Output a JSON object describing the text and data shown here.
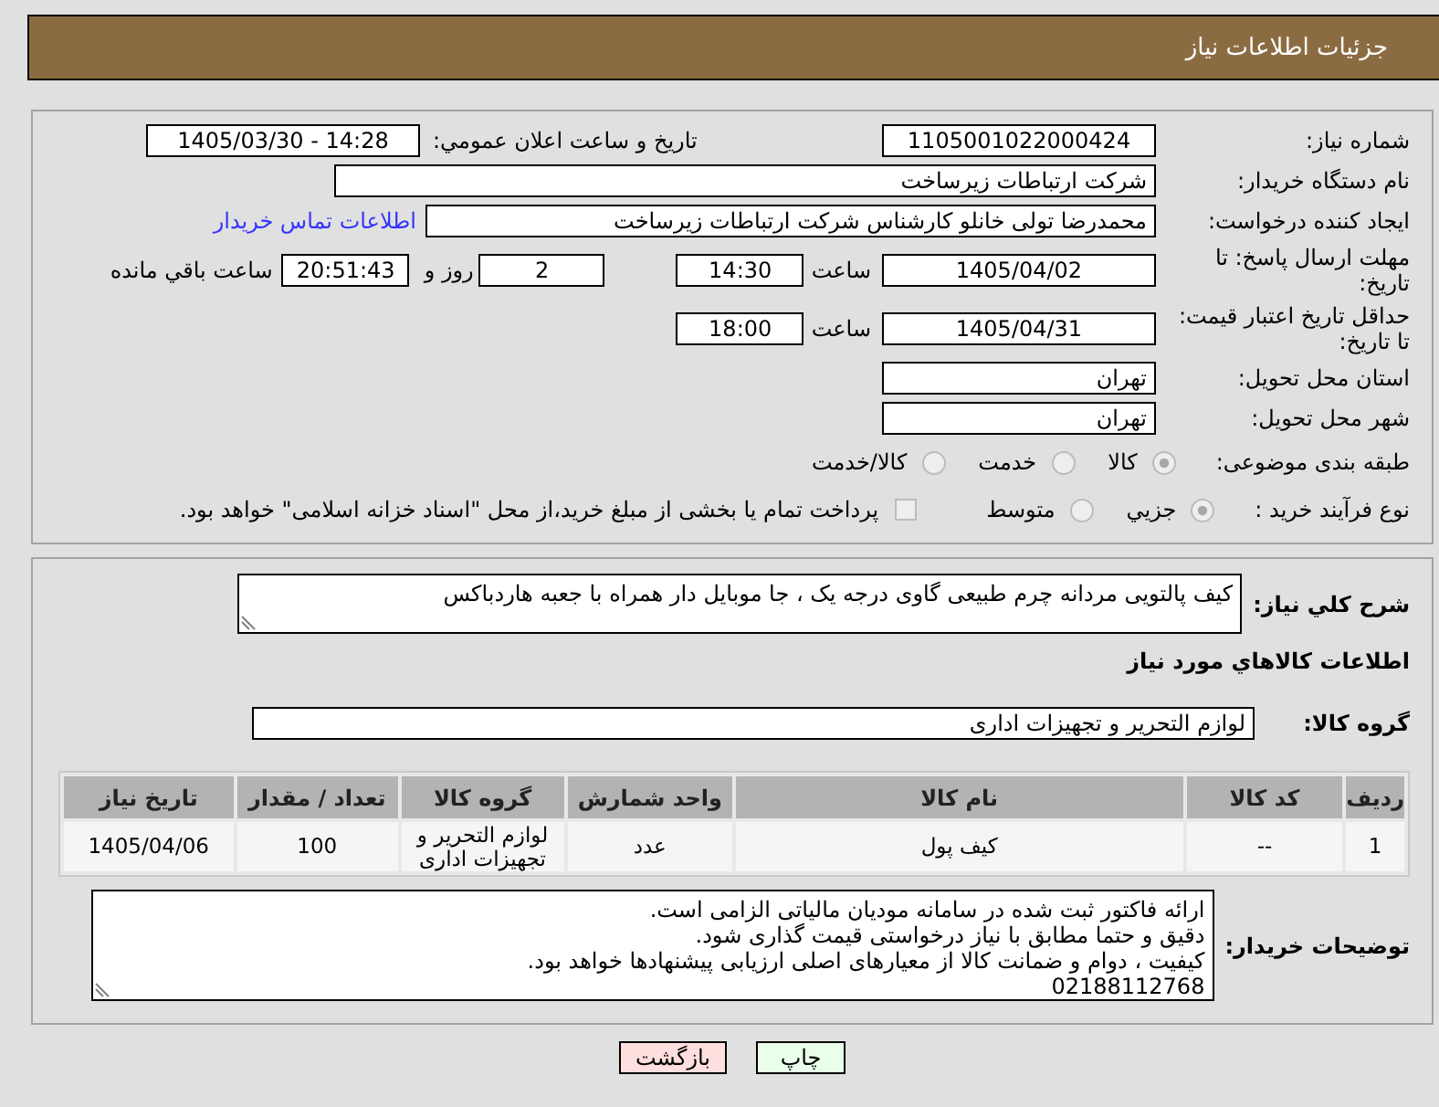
{
  "header": {
    "title": "جزئیات اطلاعات نیاز"
  },
  "need": {
    "number": {
      "label": "شماره نیاز:",
      "value": "1105001022000424"
    },
    "announced": {
      "label": "تاریخ و ساعت اعلان عمومي:",
      "value": "1405/03/30 - 14:28"
    },
    "buyer": {
      "label": "نام دستگاه خریدار:",
      "value": "شرکت ارتباطات زیرساخت"
    },
    "requester": {
      "label": "ایجاد کننده درخواست:",
      "value": "محمدرضا تولی خانلو کارشناس شرکت ارتباطات زیرساخت",
      "contact_link": "اطلاعات تماس خریدار"
    },
    "reply_deadline": {
      "label": "مهلت ارسال پاسخ: تا تاریخ:",
      "date": "1405/04/02",
      "time_label": "ساعت",
      "time": "14:30",
      "days": "2",
      "days_label": "روز و",
      "remaining": "20:51:43",
      "remaining_label": "ساعت باقي مانده"
    },
    "price_validity": {
      "label": "حداقل تاریخ اعتبار قیمت: تا تاریخ:",
      "date": "1405/04/31",
      "time_label": "ساعت",
      "time": "18:00"
    },
    "province": {
      "label": "استان محل تحویل:",
      "value": "تهران"
    },
    "city": {
      "label": "شهر محل تحویل:",
      "value": "تهران"
    },
    "category": {
      "label": "طبقه بندی موضوعی:",
      "options": [
        {
          "label": "کالا",
          "selected": true
        },
        {
          "label": "خدمت",
          "selected": false
        },
        {
          "label": "کالا/خدمت",
          "selected": false
        }
      ]
    },
    "process": {
      "label": "نوع فرآیند خرید :",
      "options": [
        {
          "label": "جزيي",
          "selected": true
        },
        {
          "label": "متوسط",
          "selected": false
        }
      ],
      "treasury": {
        "label": "پرداخت تمام یا بخشی از مبلغ خرید،از محل \"اسناد خزانه اسلامی\" خواهد بود.",
        "checked": false
      }
    }
  },
  "goods": {
    "description": {
      "label": "شرح کلي نیاز:",
      "value": "کیف پالتویی مردانه چرم طبیعی گاوی درجه یک ، جا موبایل دار همراه با جعبه هاردباکس"
    },
    "section_title": "اطلاعات کالاهاي مورد نیاز",
    "group": {
      "label": "گروه کالا:",
      "value": "لوازم التحریر و تجهیزات اداری"
    },
    "table": {
      "columns": [
        "ردیف",
        "کد کالا",
        "نام کالا",
        "واحد شمارش",
        "گروه کالا",
        "تعداد / مقدار",
        "تاریخ نیاز"
      ],
      "rows": [
        [
          "1",
          "--",
          "کیف پول",
          "عدد",
          "لوازم التحریر و تجهیزات اداری",
          "100",
          "1405/04/06"
        ]
      ]
    },
    "buyer_notes": {
      "label": "توضیحات خریدار:",
      "lines": [
        "ارائه فاکتور ثبت شده در سامانه مودیان مالیاتی الزامی است.",
        "دقیق و حتما مطابق با نیاز درخواستی قیمت گذاری شود.",
        "کیفیت ، دوام و ضمانت کالا از معیارهای اصلی ارزیابی پیشنهادها خواهد بود.",
        "02188112768"
      ]
    }
  },
  "buttons": [
    {
      "label": "چاپ",
      "kind": "print"
    },
    {
      "label": "بازگشت",
      "kind": "back"
    }
  ]
}
